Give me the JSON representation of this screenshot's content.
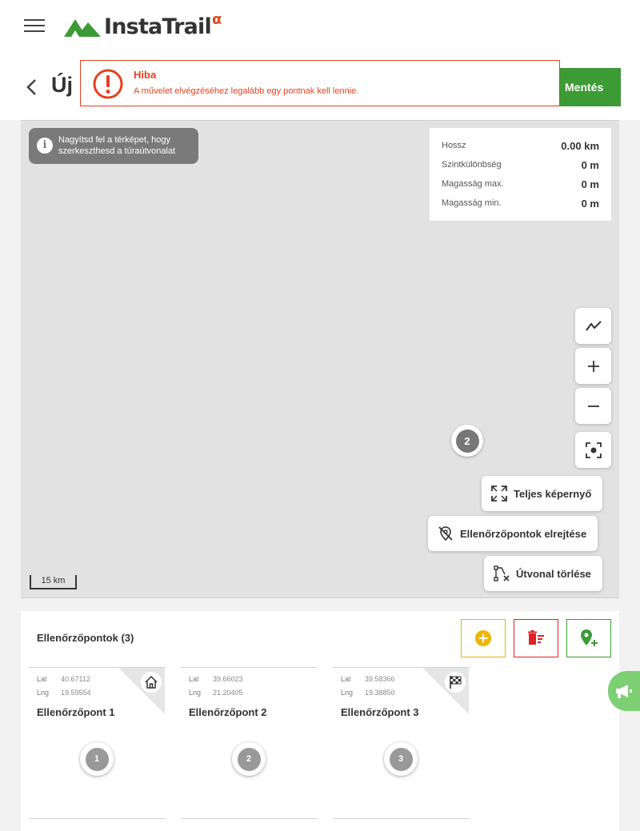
{
  "app": {
    "logo_text": "InstaTrail",
    "logo_badge": "α"
  },
  "header": {
    "title": "Új",
    "save_label": "Mentés"
  },
  "alert": {
    "title": "Hiba",
    "message": "A művelet elvégzéséhez legalább egy pontnak kell lennie."
  },
  "map": {
    "zoom_hint": "Nagyítsd fel a térképet, hogy szerkeszthesd a túraútvonalat",
    "stats": [
      {
        "label": "Hossz",
        "value": "0.00 km"
      },
      {
        "label": "Szintkülönbség",
        "value": "0 m"
      },
      {
        "label": "Magasság max.",
        "value": "0 m"
      },
      {
        "label": "Magasság min.",
        "value": "0 m"
      }
    ],
    "cluster_count": "2",
    "scale_label": "15 km",
    "buttons": {
      "fullscreen": "Teljes képernyő",
      "hide_checkpoints": "Ellenőrzőpontok elrejtése",
      "clear_route": "Útvonal törlése"
    }
  },
  "checkpoints": {
    "title": "Ellenőrzőpontok (3)",
    "lat_label": "Lat",
    "lng_label": "Lng",
    "items": [
      {
        "lat": "40.67112",
        "lng": "19.59554",
        "name": "Ellenőrzőpont 1",
        "number": "1",
        "corner_icon": "home-icon"
      },
      {
        "lat": "39.66023",
        "lng": "21.20405",
        "name": "Ellenőrzőpont 2",
        "number": "2",
        "corner_icon": ""
      },
      {
        "lat": "39.58366",
        "lng": "19.38850",
        "name": "Ellenőrzőpont 3",
        "number": "3",
        "corner_icon": "finish-flag-icon"
      }
    ]
  },
  "colors": {
    "brand_green": "#3c9b35",
    "error_red": "#e4401f",
    "add_yellow": "#f0b400",
    "delete_red": "#d22222"
  }
}
